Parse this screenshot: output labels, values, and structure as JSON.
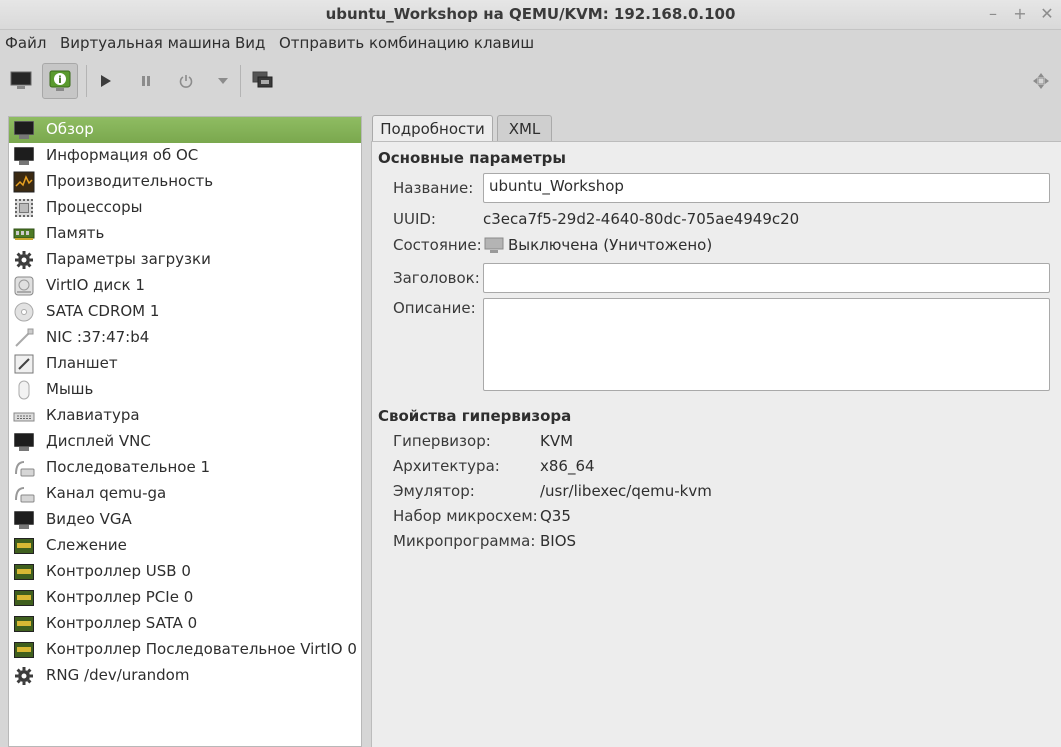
{
  "window": {
    "title": "ubuntu_Workshop на QEMU/KVM: 192.168.0.100",
    "buttons": [
      "–",
      "+",
      "✕"
    ]
  },
  "menu": [
    "Файл",
    "Виртуальная машина",
    "Вид",
    "Отправить комбинацию клавиш"
  ],
  "sidebar": {
    "items": [
      {
        "label": "Обзор",
        "icon": "monitor-icon"
      },
      {
        "label": "Информация об ОС",
        "icon": "monitor-icon"
      },
      {
        "label": "Производительность",
        "icon": "performance-icon"
      },
      {
        "label": "Процессоры",
        "icon": "cpu-icon"
      },
      {
        "label": "Память",
        "icon": "memory-icon"
      },
      {
        "label": "Параметры загрузки",
        "icon": "gear-icon"
      },
      {
        "label": "VirtIO диск 1",
        "icon": "disk-icon"
      },
      {
        "label": "SATA CDROM 1",
        "icon": "cdrom-icon"
      },
      {
        "label": "NIC :37:47:b4",
        "icon": "network-icon"
      },
      {
        "label": "Планшет",
        "icon": "tablet-icon"
      },
      {
        "label": "Мышь",
        "icon": "mouse-icon"
      },
      {
        "label": "Клавиатура",
        "icon": "keyboard-icon"
      },
      {
        "label": "Дисплей VNC",
        "icon": "monitor-icon"
      },
      {
        "label": "Последовательное 1",
        "icon": "serial-icon"
      },
      {
        "label": "Канал qemu-ga",
        "icon": "serial-icon"
      },
      {
        "label": "Видео VGA",
        "icon": "monitor-icon"
      },
      {
        "label": "Слежение",
        "icon": "controller-card-icon"
      },
      {
        "label": "Контроллер USB 0",
        "icon": "controller-card-icon"
      },
      {
        "label": "Контроллер PCIe 0",
        "icon": "controller-card-icon"
      },
      {
        "label": "Контроллер SATA 0",
        "icon": "controller-card-icon"
      },
      {
        "label": "Контроллер Последовательное VirtIO 0",
        "icon": "controller-card-icon"
      },
      {
        "label": "RNG /dev/urandom",
        "icon": "gear-icon"
      }
    ]
  },
  "tabs": [
    "Подробности",
    "XML"
  ],
  "basic": {
    "heading": "Основные параметры",
    "name_label": "Название:",
    "name_value": "ubuntu_Workshop",
    "uuid_label": "UUID:",
    "uuid_value": "c3eca7f5-29d2-4640-80dc-705ae4949c20",
    "state_label": "Состояние:",
    "state_value": "Выключена (Уничтожено)",
    "title_label": "Заголовок:",
    "title_value": "",
    "desc_label": "Описание:",
    "desc_value": ""
  },
  "hypervisor": {
    "heading": "Свойства гипервизора",
    "rows": [
      {
        "label": "Гипервизор:",
        "value": "KVM"
      },
      {
        "label": "Архитектура:",
        "value": "x86_64"
      },
      {
        "label": "Эмулятор:",
        "value": "/usr/libexec/qemu-kvm"
      },
      {
        "label": "Набор микросхем:",
        "value": "Q35"
      },
      {
        "label": "Микропрограмма:",
        "value": "BIOS"
      }
    ]
  },
  "colors": {
    "selection": "#80ae54",
    "background": "#d6d6d6",
    "panel": "#ededed"
  }
}
